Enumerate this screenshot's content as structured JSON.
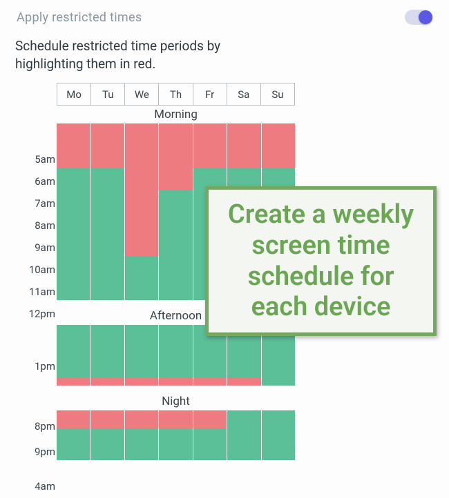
{
  "header": {
    "toggle_label": "Apply restricted times",
    "toggle_on": true
  },
  "subtitle": "Schedule restricted time periods by highlighting them in red.",
  "days": [
    "Mo",
    "Tu",
    "We",
    "Th",
    "Fr",
    "Sa",
    "Su"
  ],
  "sections": {
    "morning": {
      "label": "Morning",
      "times": [
        "5am",
        "6am",
        "7am",
        "8am",
        "9am",
        "10am",
        "11am",
        "12pm"
      ],
      "rows": [
        [
          "red",
          "red",
          "red",
          "red",
          "red",
          "red",
          "red"
        ],
        [
          "red",
          "red",
          "red",
          "red",
          "red",
          "red",
          "red"
        ],
        [
          "green",
          "green",
          "red",
          "red",
          "green",
          "green",
          "green"
        ],
        [
          "green",
          "green",
          "red",
          "green",
          "green",
          "green",
          "green"
        ],
        [
          "green",
          "green",
          "red",
          "green",
          "green",
          "green",
          "green"
        ],
        [
          "green",
          "green",
          "red",
          "green",
          "green",
          "green",
          "green"
        ],
        [
          "green",
          "green",
          "green",
          "green",
          "green",
          "green",
          "green"
        ],
        [
          "green",
          "green",
          "green",
          "green",
          "green",
          "green",
          "green"
        ]
      ]
    },
    "afternoon": {
      "label": "Afternoon",
      "start_label": "1pm",
      "end_label": "8pm",
      "body_state": "green",
      "bottom_row": [
        "red",
        "red",
        "red",
        "red",
        "red",
        "red",
        "green"
      ]
    },
    "night": {
      "label": "Night",
      "start_label": "9pm",
      "end_label": "4am",
      "top_row": [
        "red",
        "red",
        "red",
        "red",
        "red",
        "green",
        "green"
      ],
      "bottom_state": "green"
    }
  },
  "callout": "Create a weekly screen time schedule for each device",
  "colors": {
    "green": "#5bbf97",
    "red": "#ee7b80",
    "accent": "#5a59e5"
  }
}
